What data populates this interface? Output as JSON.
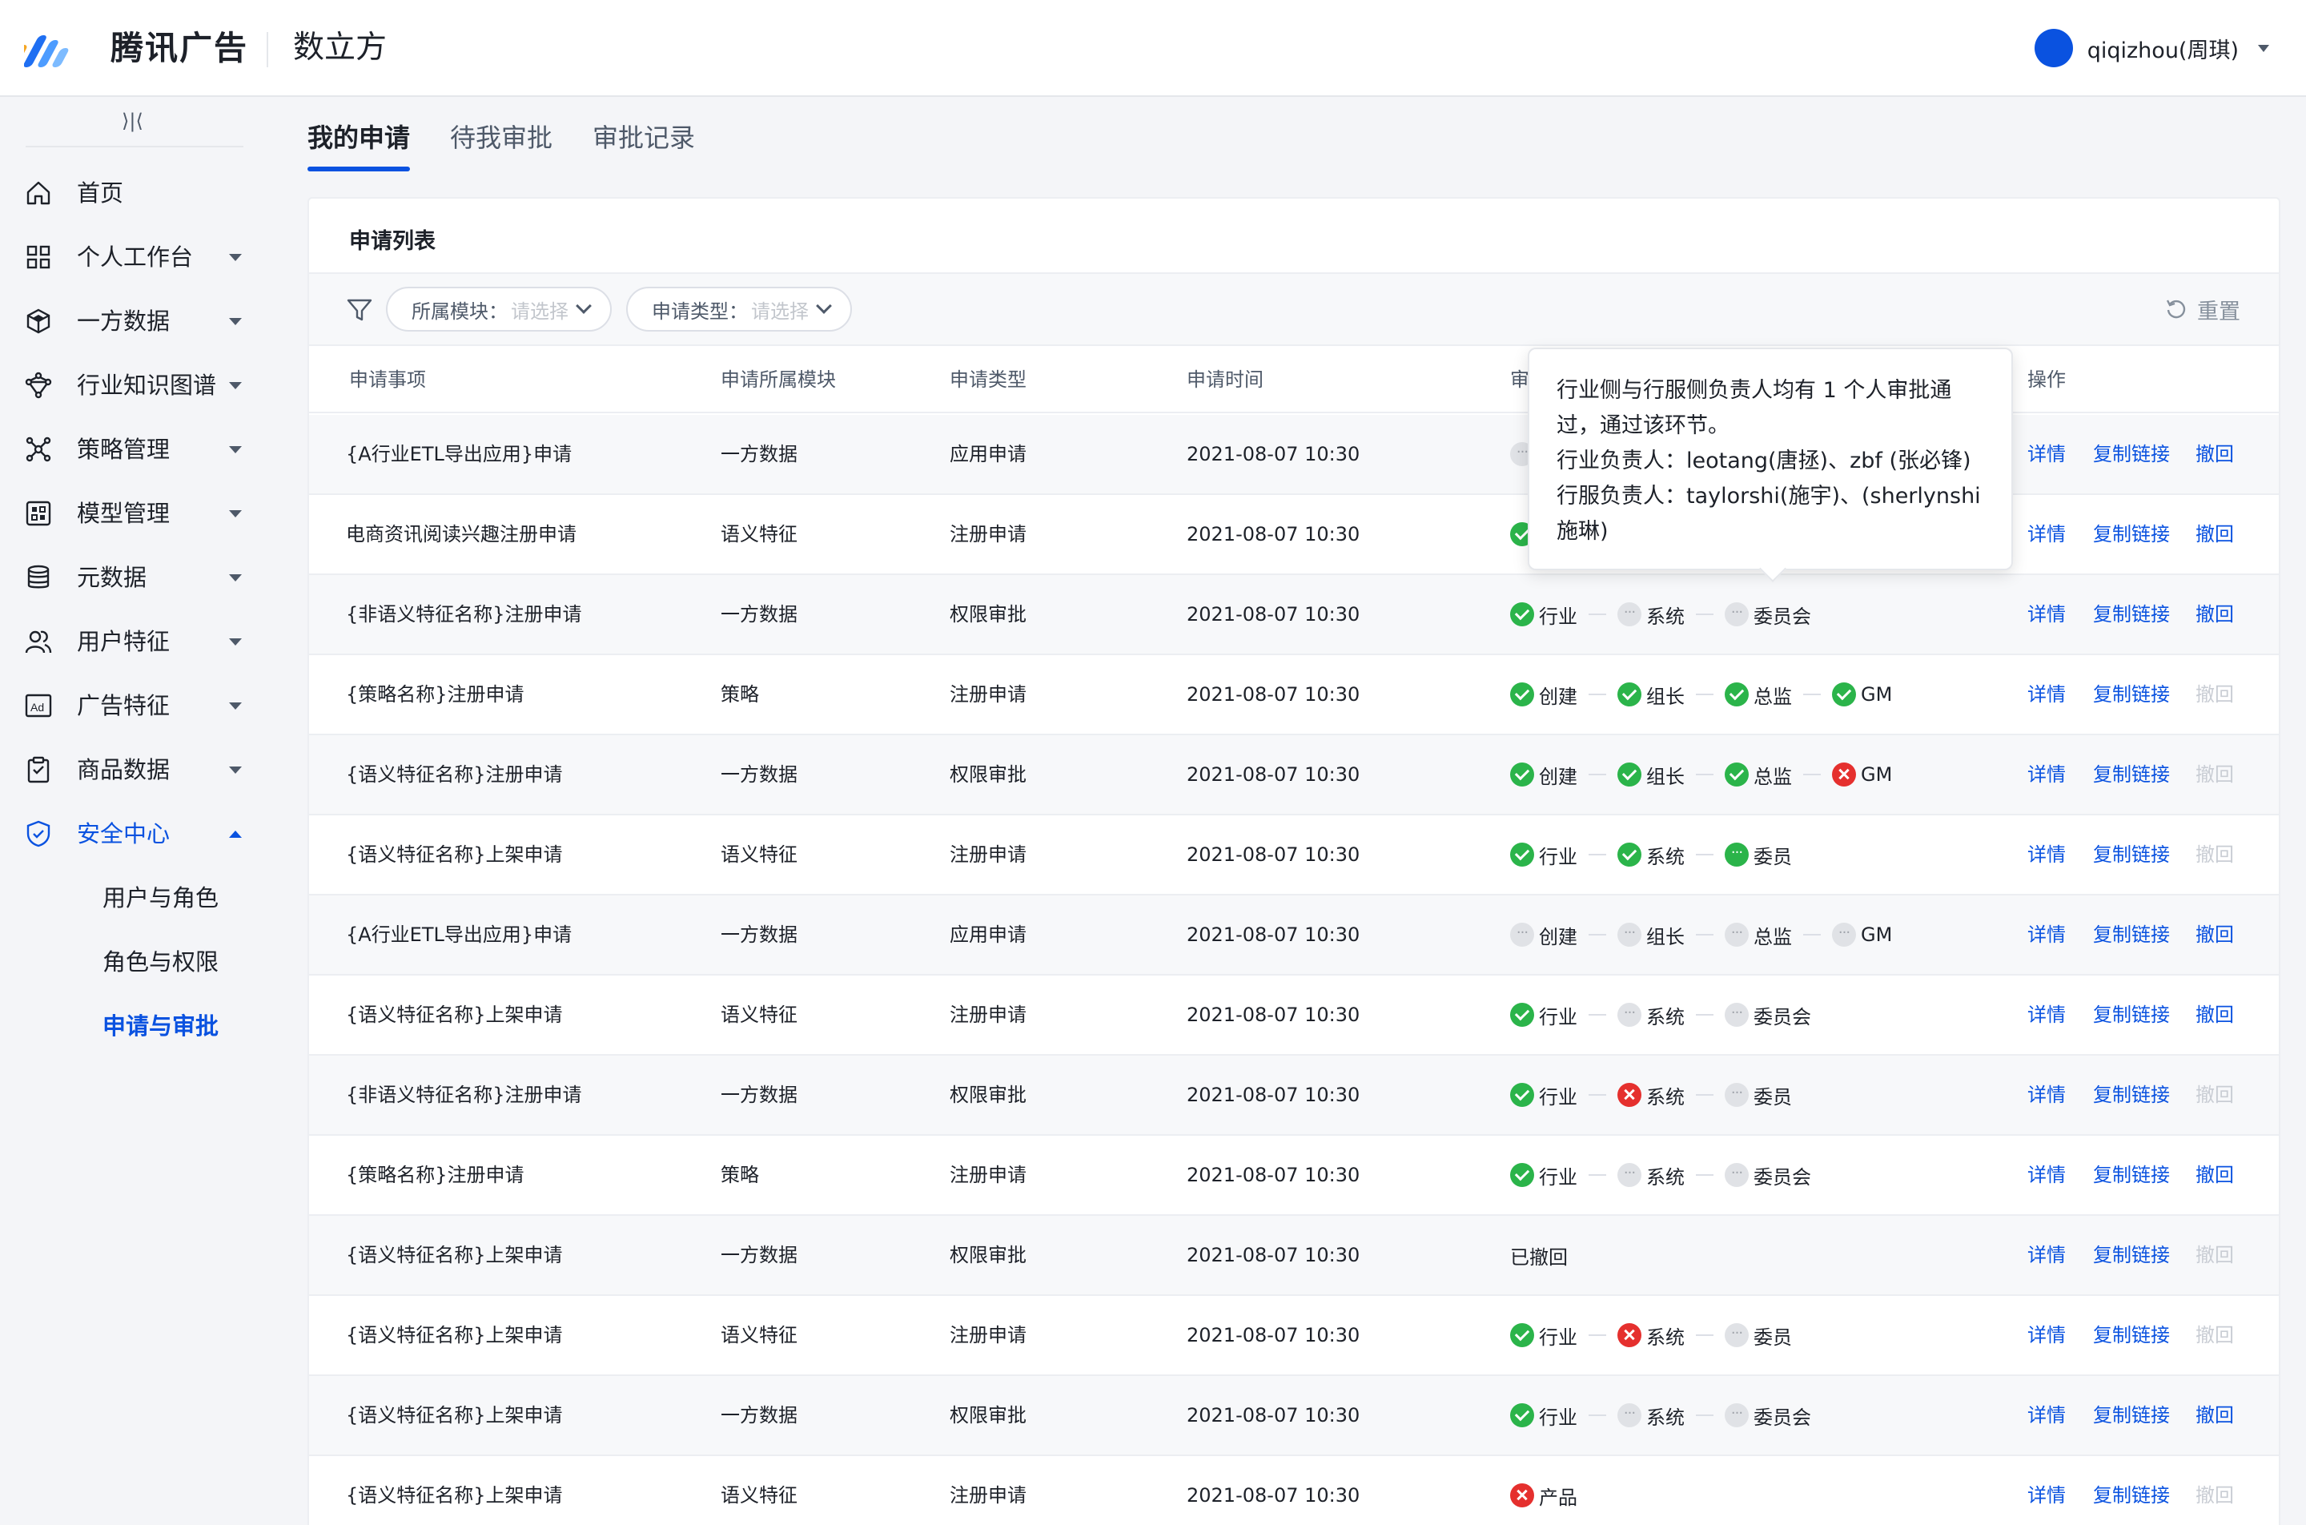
{
  "header": {
    "brand": "腾讯广告",
    "product": "数立方",
    "user": "qiqizhou(周琪)"
  },
  "sidebar": {
    "items": [
      {
        "label": "首页",
        "icon": "home-icon",
        "expandable": false
      },
      {
        "label": "个人工作台",
        "icon": "grid-icon",
        "expandable": true
      },
      {
        "label": "一方数据",
        "icon": "cube-icon",
        "expandable": true
      },
      {
        "label": "行业知识图谱",
        "icon": "graph-icon",
        "expandable": true
      },
      {
        "label": "策略管理",
        "icon": "strategy-icon",
        "expandable": true
      },
      {
        "label": "模型管理",
        "icon": "model-icon",
        "expandable": true
      },
      {
        "label": "元数据",
        "icon": "database-icon",
        "expandable": true
      },
      {
        "label": "用户特征",
        "icon": "users-icon",
        "expandable": true
      },
      {
        "label": "广告特征",
        "icon": "ad-icon",
        "expandable": true
      },
      {
        "label": "商品数据",
        "icon": "clipboard-icon",
        "expandable": true
      },
      {
        "label": "安全中心",
        "icon": "shield-icon",
        "expandable": true,
        "expanded": true,
        "active": true
      }
    ],
    "subitems": [
      {
        "label": "用户与角色",
        "active": false
      },
      {
        "label": "角色与权限",
        "active": false
      },
      {
        "label": "申请与审批",
        "active": true
      }
    ]
  },
  "tabs": [
    {
      "label": "我的申请",
      "active": true
    },
    {
      "label": "待我审批",
      "active": false
    },
    {
      "label": "审批记录",
      "active": false
    }
  ],
  "card": {
    "title": "申请列表"
  },
  "filters": {
    "module": {
      "label": "所属模块：",
      "placeholder": "请选择"
    },
    "type": {
      "label": "申请类型：",
      "placeholder": "请选择"
    },
    "reset": "重置"
  },
  "table": {
    "columns": [
      "申请事项",
      "申请所属模块",
      "申请类型",
      "申请时间",
      "审",
      "操作"
    ],
    "actions": {
      "detail": "详情",
      "copy": "复制链接",
      "revoke": "撤回"
    },
    "rows": [
      {
        "item": "{A行业ETL导出应用}申请",
        "module": "一方数据",
        "type": "应用申请",
        "time": "2021-08-07 10:30",
        "steps": [
          {
            "s": "pend",
            "l": ""
          }
        ],
        "revoke": true
      },
      {
        "item": "电商资讯阅读兴趣注册申请",
        "module": "语义特征",
        "type": "注册申请",
        "time": "2021-08-07 10:30",
        "steps": [
          {
            "s": "ok",
            "l": ""
          }
        ],
        "revoke": true
      },
      {
        "item": "{非语义特征名称}注册申请",
        "module": "一方数据",
        "type": "权限审批",
        "time": "2021-08-07 10:30",
        "steps": [
          {
            "s": "ok",
            "l": "行业"
          },
          {
            "s": "pend",
            "l": "系统"
          },
          {
            "s": "pend",
            "l": "委员会"
          }
        ],
        "revoke": true
      },
      {
        "item": "{策略名称}注册申请",
        "module": "策略",
        "type": "注册申请",
        "time": "2021-08-07 10:30",
        "steps": [
          {
            "s": "ok",
            "l": "创建"
          },
          {
            "s": "ok",
            "l": "组长"
          },
          {
            "s": "ok",
            "l": "总监"
          },
          {
            "s": "ok",
            "l": "GM"
          }
        ],
        "revoke": false
      },
      {
        "item": "{语义特征名称}注册申请",
        "module": "一方数据",
        "type": "权限审批",
        "time": "2021-08-07 10:30",
        "steps": [
          {
            "s": "ok",
            "l": "创建"
          },
          {
            "s": "ok",
            "l": "组长"
          },
          {
            "s": "ok",
            "l": "总监"
          },
          {
            "s": "no",
            "l": "GM"
          }
        ],
        "revoke": false
      },
      {
        "item": "{语义特征名称}上架申请",
        "module": "语义特征",
        "type": "注册申请",
        "time": "2021-08-07 10:30",
        "steps": [
          {
            "s": "ok",
            "l": "行业"
          },
          {
            "s": "ok",
            "l": "系统"
          },
          {
            "s": "prog",
            "l": "委员"
          }
        ],
        "revoke": false
      },
      {
        "item": "{A行业ETL导出应用}申请",
        "module": "一方数据",
        "type": "应用申请",
        "time": "2021-08-07 10:30",
        "steps": [
          {
            "s": "pend",
            "l": "创建"
          },
          {
            "s": "pend",
            "l": "组长"
          },
          {
            "s": "pend",
            "l": "总监"
          },
          {
            "s": "pend",
            "l": "GM"
          }
        ],
        "revoke": true
      },
      {
        "item": "{语义特征名称}上架申请",
        "module": "语义特征",
        "type": "注册申请",
        "time": "2021-08-07 10:30",
        "steps": [
          {
            "s": "ok",
            "l": "行业"
          },
          {
            "s": "pend",
            "l": "系统"
          },
          {
            "s": "pend",
            "l": "委员会"
          }
        ],
        "revoke": true
      },
      {
        "item": "{非语义特征名称}注册申请",
        "module": "一方数据",
        "type": "权限审批",
        "time": "2021-08-07 10:30",
        "steps": [
          {
            "s": "ok",
            "l": "行业"
          },
          {
            "s": "no",
            "l": "系统"
          },
          {
            "s": "pend",
            "l": "委员"
          }
        ],
        "revoke": false
      },
      {
        "item": "{策略名称}注册申请",
        "module": "策略",
        "type": "注册申请",
        "time": "2021-08-07 10:30",
        "steps": [
          {
            "s": "ok",
            "l": "行业"
          },
          {
            "s": "pend",
            "l": "系统"
          },
          {
            "s": "pend",
            "l": "委员会"
          }
        ],
        "revoke": true
      },
      {
        "item": "{语义特征名称}上架申请",
        "module": "一方数据",
        "type": "权限审批",
        "time": "2021-08-07 10:30",
        "status_text": "已撤回",
        "steps": [],
        "revoke": false
      },
      {
        "item": "{语义特征名称}上架申请",
        "module": "语义特征",
        "type": "注册申请",
        "time": "2021-08-07 10:30",
        "steps": [
          {
            "s": "ok",
            "l": "行业"
          },
          {
            "s": "no",
            "l": "系统"
          },
          {
            "s": "pend",
            "l": "委员"
          }
        ],
        "revoke": false
      },
      {
        "item": "{语义特征名称}上架申请",
        "module": "一方数据",
        "type": "权限审批",
        "time": "2021-08-07 10:30",
        "steps": [
          {
            "s": "ok",
            "l": "行业"
          },
          {
            "s": "pend",
            "l": "系统"
          },
          {
            "s": "pend",
            "l": "委员会"
          }
        ],
        "revoke": true
      },
      {
        "item": "{语义特征名称}上架申请",
        "module": "语义特征",
        "type": "注册申请",
        "time": "2021-08-07 10:30",
        "steps": [
          {
            "s": "no",
            "l": "产品"
          }
        ],
        "revoke": false
      }
    ]
  },
  "tooltip": {
    "lines": [
      "行业侧与行服侧负责人均有 1 个人审批通过，通过该环节。",
      "行业负责人：leotang(唐拯)、zbf (张必锋)",
      "行服负责人：taylorshi(施宇)、(sherlynshi 施琳)"
    ]
  },
  "colors": {
    "accent": "#0a52e0",
    "success": "#2bb44a",
    "danger": "#e5302e",
    "pending": "#e0e2e6"
  }
}
